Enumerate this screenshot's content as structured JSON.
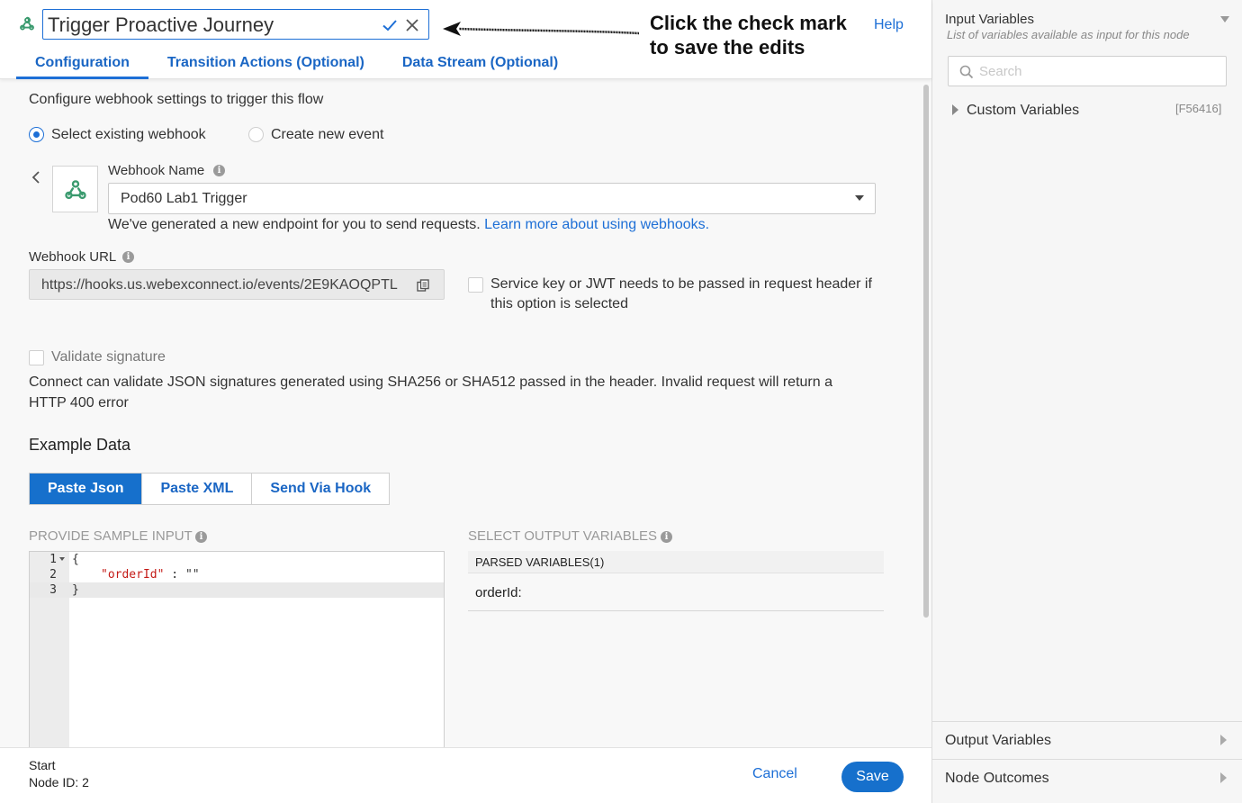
{
  "header": {
    "node_title": "Trigger Proactive Journey",
    "callout": "Click the check mark to save the edits",
    "help": "Help"
  },
  "tabs": [
    {
      "label": "Configuration",
      "active": true
    },
    {
      "label": "Transition Actions (Optional)",
      "active": false
    },
    {
      "label": "Data Stream (Optional)",
      "active": false
    }
  ],
  "config": {
    "intro": "Configure webhook settings to trigger this flow",
    "radio_existing": "Select existing webhook",
    "radio_new": "Create new event",
    "webhook_name_label": "Webhook Name",
    "webhook_name_value": "Pod60 Lab1 Trigger",
    "endpoint_note": "We've generated a new endpoint for you to send requests.",
    "learn_more": "Learn more about using webhooks.",
    "webhook_url_label": "Webhook URL",
    "webhook_url_value": "https://hooks.us.webexconnect.io/events/2E9KAOQPTL",
    "service_key_text": "Service key or JWT needs to be passed in request header if this option is selected",
    "validate_label": "Validate signature",
    "validate_note": "Connect can validate JSON signatures generated using SHA256 or SHA512 passed in the header. Invalid request will return a HTTP 400 error",
    "example_data": "Example Data",
    "seg_buttons": [
      "Paste Json",
      "Paste XML",
      "Send Via Hook"
    ],
    "sample_input_label": "PROVIDE SAMPLE INPUT",
    "output_vars_label": "SELECT OUTPUT VARIABLES",
    "parsed_vars": "PARSED VARIABLES(1)",
    "parsed_item": "orderId:",
    "code_lines": [
      {
        "n": "1",
        "code": "{"
      },
      {
        "n": "2",
        "key": "\"orderId\"",
        "sep": " : ",
        "val": "\"\""
      },
      {
        "n": "3",
        "code": "}"
      }
    ]
  },
  "footer": {
    "node_label": "Start",
    "node_id": "Node ID: 2",
    "cancel": "Cancel",
    "save": "Save"
  },
  "right_panel": {
    "title": "Input Variables",
    "subtitle": "List of variables available as input for this node",
    "search_placeholder": "Search",
    "custom_vars": "Custom Variables",
    "custom_code": "[F56416]",
    "output_vars": "Output Variables",
    "node_outcomes": "Node Outcomes"
  },
  "colors": {
    "accent": "#1d6fd6",
    "webhook_green": "#3a9a6e"
  }
}
